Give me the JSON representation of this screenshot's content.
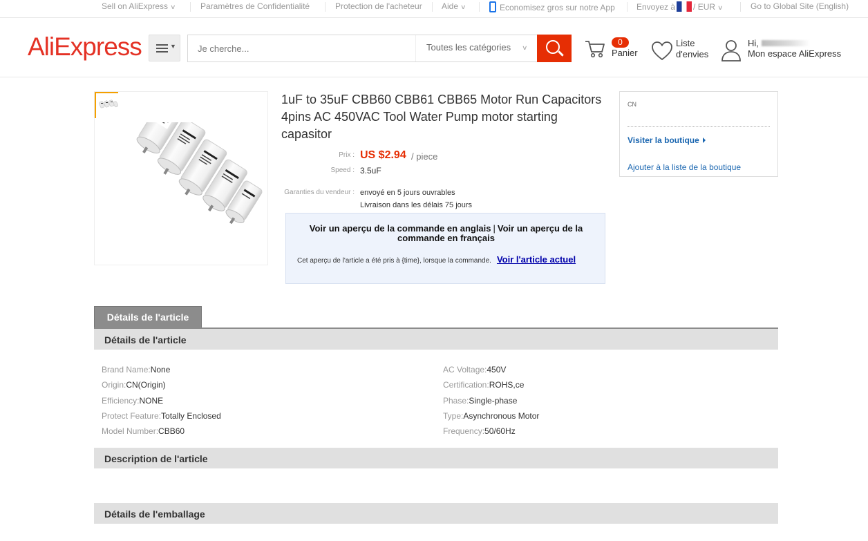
{
  "topbar": {
    "sell": "Sell on AliExpress",
    "privacy": "Paramètres de Confidentialité",
    "protection": "Protection de l'acheteur",
    "help": "Aide",
    "app": "Economisez gros sur notre App",
    "ship_to": "Envoyez à",
    "currency": "/ EUR",
    "global": "Go to Global Site (English)"
  },
  "header": {
    "logo": "AliExpress",
    "search_placeholder": "Je cherche...",
    "category": "Toutes les catégories",
    "cart_count": "0",
    "cart_label": "Panier",
    "wishlist_line1": "Liste",
    "wishlist_line2": "d'envies",
    "account_hi": "Hi,",
    "account_space": "Mon espace AliExpress"
  },
  "product": {
    "title": "1uF to 35uF CBB60 CBB61 CBB65 Motor Run Capacitors 4pins AC 450VAC Tool Water Pump motor starting capasitor",
    "price_label": "Prix :",
    "price": "US $2.94",
    "unit": "/ piece",
    "speed_label": "Speed :",
    "speed": "3.5uF",
    "guarantee_label": "Garanties du vendeur :",
    "guarantee_1": "envoyé en 5 jours ouvrables",
    "guarantee_2": "Livraison dans les délais 75 jours"
  },
  "snapshot": {
    "title_en": "Voir un aperçu de la commande en anglais",
    "divider": "|",
    "title_fr": "Voir un aperçu de la commande en français",
    "note": "Cet aperçu de l'article a été pris à {time}, lorsque la commande.",
    "link": "Voir l'article actuel"
  },
  "store": {
    "country": "CN",
    "visit": "Visiter la boutique",
    "add": "Ajouter à la liste de la boutique"
  },
  "tabs": {
    "active": "Détails de l'article"
  },
  "sections": {
    "details": "Détails de l'article",
    "description": "Description de l'article",
    "packaging": "Détails de l'emballage"
  },
  "attributes_left": [
    {
      "key": "Brand Name:",
      "value": "None"
    },
    {
      "key": "Origin:",
      "value": "CN(Origin)"
    },
    {
      "key": "Efficiency:",
      "value": "NONE"
    },
    {
      "key": "Protect Feature:",
      "value": "Totally Enclosed"
    },
    {
      "key": "Model Number:",
      "value": "CBB60"
    }
  ],
  "attributes_right": [
    {
      "key": "AC Voltage:",
      "value": "450V"
    },
    {
      "key": "Certification:",
      "value": "ROHS,ce"
    },
    {
      "key": "Phase:",
      "value": "Single-phase"
    },
    {
      "key": "Type:",
      "value": "Asynchronous Motor"
    },
    {
      "key": "Frequency:",
      "value": "50/60Hz"
    }
  ],
  "colors": {
    "brand": "#e43225",
    "search_button": "#e62e04",
    "link": "#1a66b0"
  }
}
